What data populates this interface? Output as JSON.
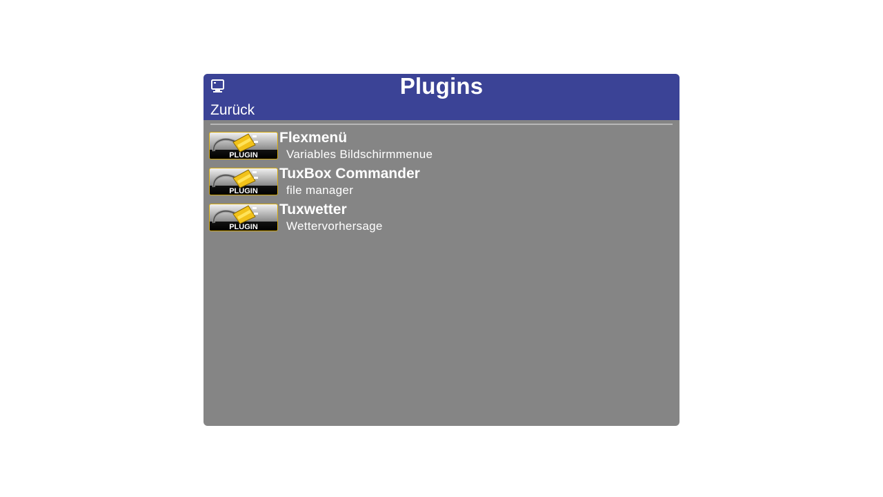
{
  "window": {
    "title": "Plugins",
    "back_label": "Zurück",
    "header_icon": "monitor-icon",
    "colors": {
      "header": "#3b4396",
      "body": "#858585",
      "plugin_border": "#d4a90c"
    }
  },
  "plugins": [
    {
      "name": "Flexmenü",
      "description": "Variables Bildschirmmenue",
      "icon": "plugin-icon",
      "icon_label": "PLUGIN"
    },
    {
      "name": "TuxBox Commander",
      "description": "file manager",
      "icon": "plugin-icon",
      "icon_label": "PLUGIN"
    },
    {
      "name": "Tuxwetter",
      "description": "Wettervorhersage",
      "icon": "plugin-icon",
      "icon_label": "PLUGIN"
    }
  ]
}
